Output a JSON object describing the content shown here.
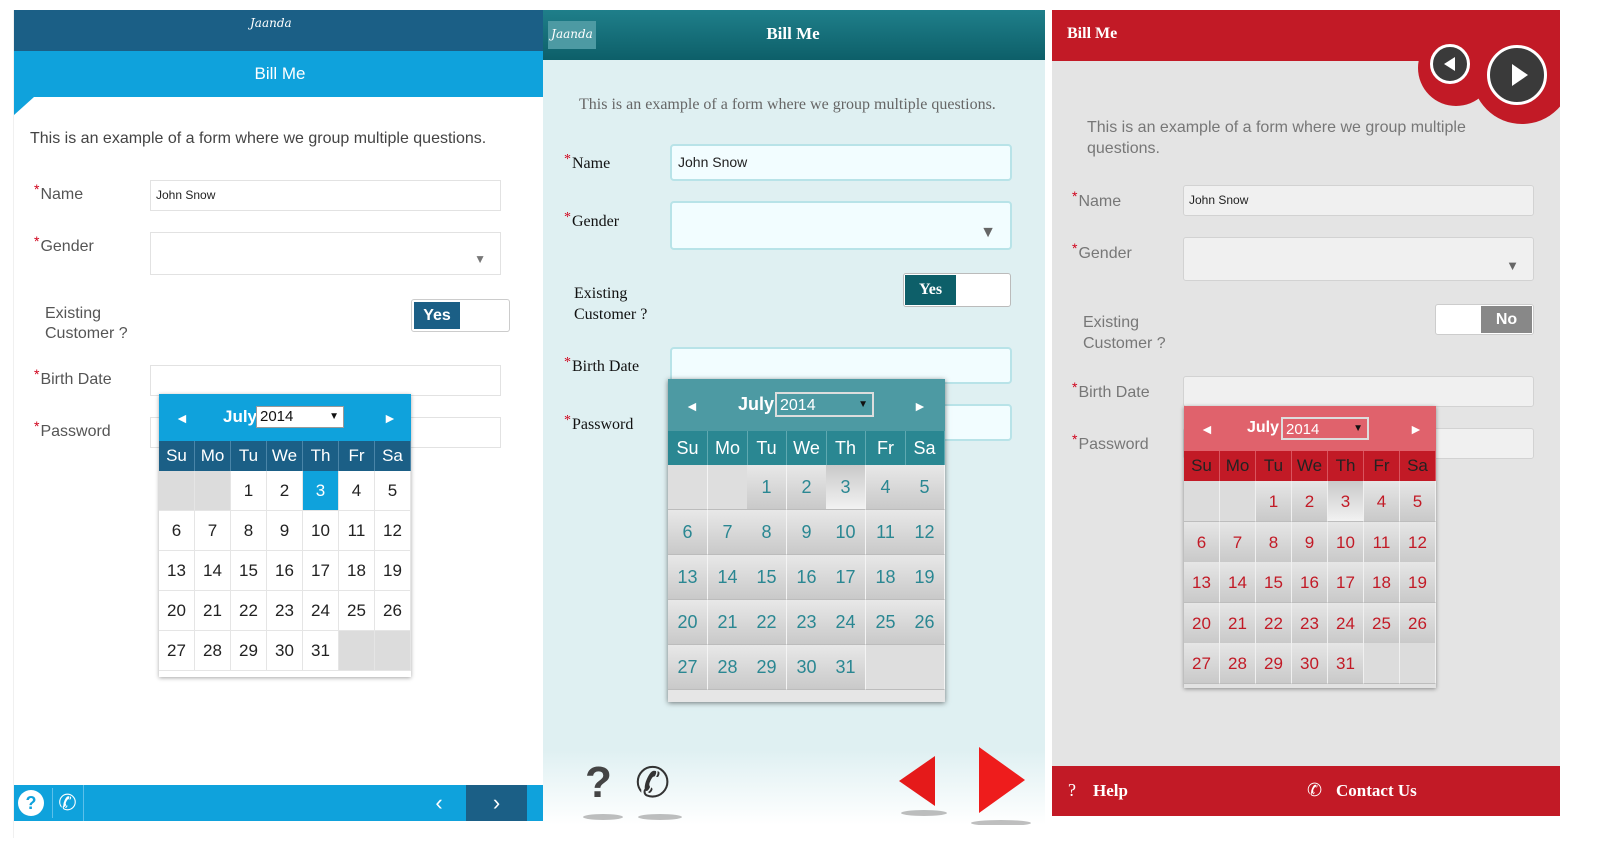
{
  "logo_text": "Jaanda",
  "p1": {
    "title": "Bill Me",
    "intro": "This is an example of a form where we group multiple questions.",
    "labels": {
      "name": "Name",
      "gender": "Gender",
      "existing1": "Existing",
      "existing2": "Customer ?",
      "birth": "Birth Date",
      "password": "Password"
    },
    "req": "*",
    "name_value": "John Snow",
    "gender_value": "",
    "select_arrow": "▼",
    "toggle_label": "Yes",
    "calendar": {
      "month": "July",
      "year": "2014",
      "prev": "◄",
      "next": "►",
      "dows": [
        "Su",
        "Mo",
        "Tu",
        "We",
        "Th",
        "Fr",
        "Sa"
      ],
      "days": [
        "",
        "",
        "1",
        "2",
        "3",
        "4",
        "5",
        "6",
        "7",
        "8",
        "9",
        "10",
        "11",
        "12",
        "13",
        "14",
        "15",
        "16",
        "17",
        "18",
        "19",
        "20",
        "21",
        "22",
        "23",
        "24",
        "25",
        "26",
        "27",
        "28",
        "29",
        "30",
        "31",
        "",
        ""
      ],
      "selected": "3"
    },
    "footer": {
      "help": "?",
      "phone": "✆",
      "prev": "‹",
      "next": "›"
    },
    "colors": {
      "dark": "#1b5f86",
      "accent": "#0fa2dc"
    }
  },
  "p2": {
    "title": "Bill Me",
    "intro": "This is an example of a form where we group multiple questions.",
    "labels": {
      "name": "Name",
      "gender": "Gender",
      "existing1": "Existing",
      "existing2": "Customer ?",
      "birth": "Birth Date",
      "password": "Password"
    },
    "req": "*",
    "name_value": "John Snow",
    "gender_value": "",
    "select_arrow": "▼",
    "toggle_label": "Yes",
    "calendar": {
      "month": "July",
      "year": "2014",
      "prev": "◄",
      "next": "►",
      "dows": [
        "Su",
        "Mo",
        "Tu",
        "We",
        "Th",
        "Fr",
        "Sa"
      ],
      "days": [
        "",
        "",
        "1",
        "2",
        "3",
        "4",
        "5",
        "6",
        "7",
        "8",
        "9",
        "10",
        "11",
        "12",
        "13",
        "14",
        "15",
        "16",
        "17",
        "18",
        "19",
        "20",
        "21",
        "22",
        "23",
        "24",
        "25",
        "26",
        "27",
        "28",
        "29",
        "30",
        "31",
        "",
        ""
      ],
      "selected": "3"
    },
    "footer": {
      "help": "?",
      "phone": "✆"
    },
    "colors": {
      "dark": "#0d5f69",
      "accent": "#2a8792",
      "arrows": "#e51a1a"
    }
  },
  "p3": {
    "title": "Bill Me",
    "intro": "This is an example of a form where we group multiple questions.",
    "labels": {
      "name": "Name",
      "gender": "Gender",
      "existing1": "Existing",
      "existing2": "Customer ?",
      "birth": "Birth Date",
      "password": "Password"
    },
    "req": "*",
    "name_value": "John Snow",
    "gender_value": "",
    "select_arrow": "▼",
    "toggle_label": "No",
    "calendar": {
      "month": "July",
      "year": "2014",
      "prev": "◄",
      "next": "►",
      "dows": [
        "Su",
        "Mo",
        "Tu",
        "We",
        "Th",
        "Fr",
        "Sa"
      ],
      "days": [
        "",
        "",
        "1",
        "2",
        "3",
        "4",
        "5",
        "6",
        "7",
        "8",
        "9",
        "10",
        "11",
        "12",
        "13",
        "14",
        "15",
        "16",
        "17",
        "18",
        "19",
        "20",
        "21",
        "22",
        "23",
        "24",
        "25",
        "26",
        "27",
        "28",
        "29",
        "30",
        "31",
        "",
        ""
      ],
      "selected": "3"
    },
    "footer": {
      "help_icon": "?",
      "help": "Help",
      "contact_icon": "✆",
      "contact": "Contact Us"
    },
    "colors": {
      "dark": "#c21a26",
      "accent": "#e0626c"
    }
  }
}
